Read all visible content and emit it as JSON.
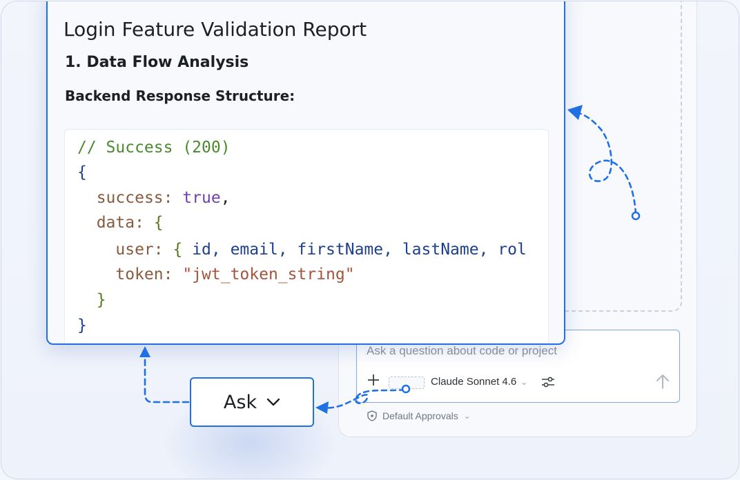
{
  "report": {
    "title": "Login Feature Validation Report",
    "section_heading": "1. Data Flow Analysis",
    "sub_heading": "Backend Response Structure:",
    "code": {
      "comment": "// Success (200)",
      "open_brace": "{",
      "success_key": "success: ",
      "success_value": "true",
      "comma": ",",
      "data_key": "data: ",
      "data_open": "{",
      "user_key": "user: ",
      "user_open": "{ ",
      "user_fields": "id, email, firstName, lastName, rol",
      "token_key": "token: ",
      "token_value": "\"jwt_token_string\"",
      "data_close": "}",
      "close_brace": "}"
    }
  },
  "ask_button": {
    "label": "Ask",
    "chevron": "⌄"
  },
  "composer": {
    "placeholder": "Ask a question about code or project",
    "model": "Claude Sonnet 4.6",
    "model_chevron": "⌄"
  },
  "approvals": {
    "label": "Default Approvals",
    "chevron": "⌄"
  },
  "icons": {
    "plus": "plus-icon",
    "settings": "sliders-icon",
    "send": "arrow-up-icon",
    "shield": "shield-icon",
    "chevron": "chevron-down-icon"
  },
  "colors": {
    "accent": "#1f6fe5",
    "background": "#f3f6fc",
    "code_comment": "#4a8a2f",
    "code_keyword": "#6e3fb3",
    "code_string": "#a5543b"
  }
}
